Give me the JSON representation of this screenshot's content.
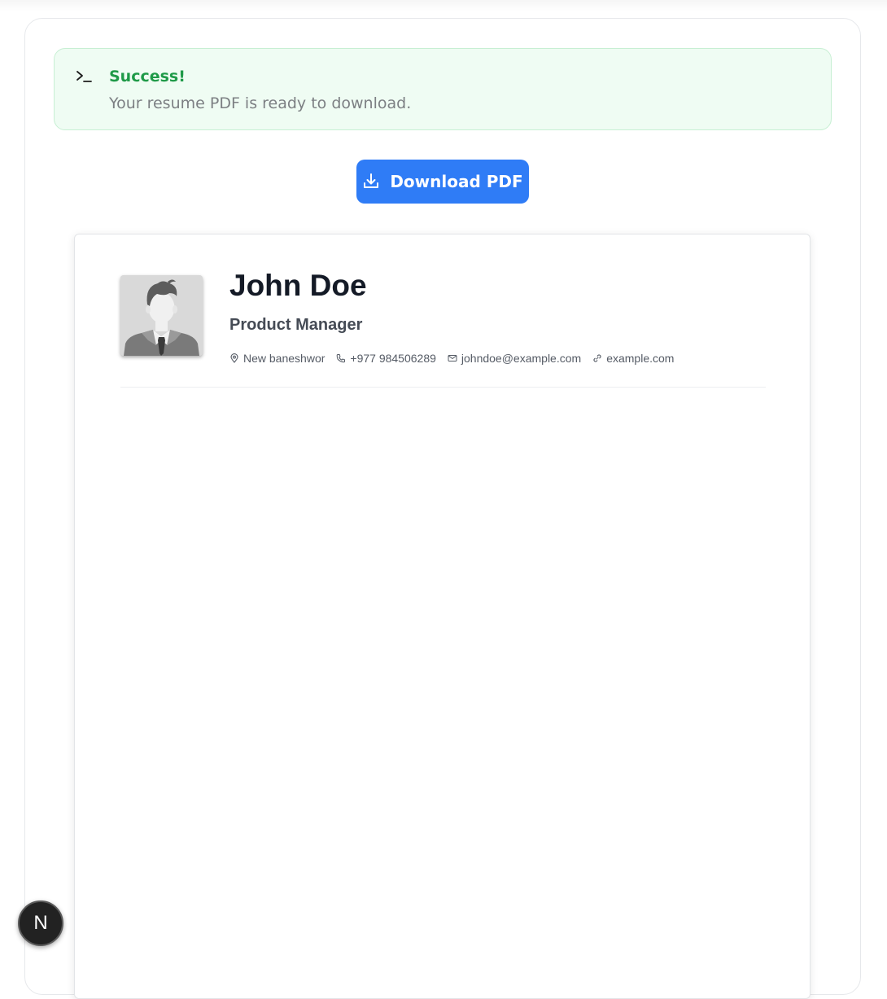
{
  "alert": {
    "title": "Success!",
    "message": "Your resume PDF is ready to download.",
    "icon": "terminal-icon",
    "title_color": "#1f9a48",
    "background": "#effcf3"
  },
  "toolbar": {
    "download_label": "Download PDF",
    "download_icon": "download-icon",
    "button_color": "#2f7cf6"
  },
  "resume": {
    "name": "John Doe",
    "title": "Product Manager",
    "avatar_icon": "avatar-placeholder-icon",
    "contact": {
      "location": "New baneshwor",
      "phone": "+977 984506289",
      "email": "johndoe@example.com",
      "website": "example.com"
    }
  },
  "dev_badge": {
    "label": "N",
    "icon": "nextjs-logo-icon"
  }
}
